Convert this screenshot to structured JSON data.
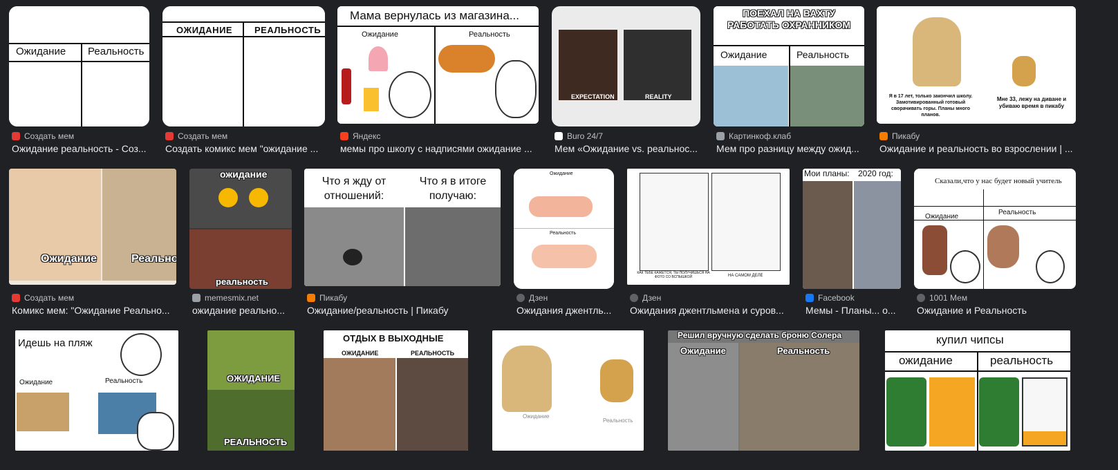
{
  "results": [
    {
      "source": "Создать мем",
      "fav_color": "#e53935",
      "title": "Ожидание реальность - Соз..."
    },
    {
      "source": "Создать мем",
      "fav_color": "#e53935",
      "title": "Создать комикс мем \"ожидание ..."
    },
    {
      "source": "Яндекс",
      "fav_color": "#fc3f1d",
      "title": "мемы про школу с надписями ожидание ..."
    },
    {
      "source": "Buro 24/7",
      "fav_color": "#ffffff",
      "title": "Мем «Ожидание vs. реальнос..."
    },
    {
      "source": "Картинкоф.клаб",
      "fav_color": "#9aa0a6",
      "title": "Мем про разницу между ожид..."
    },
    {
      "source": "Пикабу",
      "fav_color": "#f57c00",
      "title": "Ожидание и реальность во взрослении | ..."
    },
    {
      "source": "Создать мем",
      "fav_color": "#e53935",
      "title": "Комикс мем: \"Ожидание Реально..."
    },
    {
      "source": "memesmix.net",
      "fav_color": "#9aa0a6",
      "title": "ожидание реально..."
    },
    {
      "source": "Пикабу",
      "fav_color": "#f57c00",
      "title": "Ожидание/реальность | Пикабу"
    },
    {
      "source": "Дзен",
      "fav_color": "#5f6368",
      "title": "Ожидания джентль..."
    },
    {
      "source": "Дзен",
      "fav_color": "#5f6368",
      "title": "Ожидания джентльмена и суров..."
    },
    {
      "source": "Facebook",
      "fav_color": "#1877f2",
      "title": "Мемы - Планы... о..."
    },
    {
      "source": "1001 Мем",
      "fav_color": "#5f6368",
      "title": "Ожидание и Реальность"
    }
  ],
  "memes": {
    "m1": {
      "left": "Ожидание",
      "right": "Реальность"
    },
    "m2": {
      "left": "ОЖИДАНИЕ",
      "right": "РЕАЛЬНОСТЬ"
    },
    "m3": {
      "top": "Мама вернулась из магазина...",
      "left": "Ожидание",
      "right": "Реальность"
    },
    "m4": {
      "left": "EXPECTATION",
      "right": "REALITY"
    },
    "m5": {
      "top": "ПОЕХАЛ НА ВАХТУ РАБОТАТЬ ОХРАННИКОМ",
      "left": "Ожидание",
      "right": "Реальность"
    },
    "m6": {
      "left": "Я в 17 лет, только закончил школу. Замотивированный готовый сворачивать горы. Планы много планов.",
      "right": "Мне 33, лежу на диване и убиваю время в пикабу"
    },
    "m7": {
      "left": "Ожидание",
      "right": "Реальнос"
    },
    "m8": {
      "top": "ожидание",
      "bottom": "реальность"
    },
    "m9": {
      "left": "Что я жду от отношений:",
      "right": "Что я в итоге получаю:"
    },
    "m10": {
      "top": "Ожидание",
      "bottom": "Реальность"
    },
    "m11": {
      "left": "КАК ТЕБЕ КАЖЕТСЯ, ТЫ ПОЛУЧИШЬСЯ НА ФОТО СО ВСПЫШКОЙ",
      "right": "НА САМОМ ДЕЛЕ"
    },
    "m12": {
      "left": "Мои планы:",
      "right": "2020 год:"
    },
    "m13": {
      "top": "Сказали,что у нас будет новый учитель",
      "left": "Ожидание",
      "right": "Реальность"
    },
    "m14": {
      "top": "Идешь на пляж",
      "left": "Ожидание",
      "right": "Реальность"
    },
    "m15": {
      "top": "ОЖИДАНИЕ",
      "bottom": "РЕАЛЬНОСТЬ"
    },
    "m16": {
      "top": "ОТДЫХ В ВЫХОДНЫЕ",
      "left": "ОЖИДАНИЕ",
      "right": "РЕАЛЬНОСТЬ"
    },
    "m17": {
      "left": "Ожидание",
      "right": "Реальность"
    },
    "m18": {
      "top": "Решил вручную сделать броню Солера",
      "left": "Ожидание",
      "right": "Реальность"
    },
    "m19": {
      "top": "купил чипсы",
      "left": "ожидание",
      "right": "реальность"
    }
  }
}
